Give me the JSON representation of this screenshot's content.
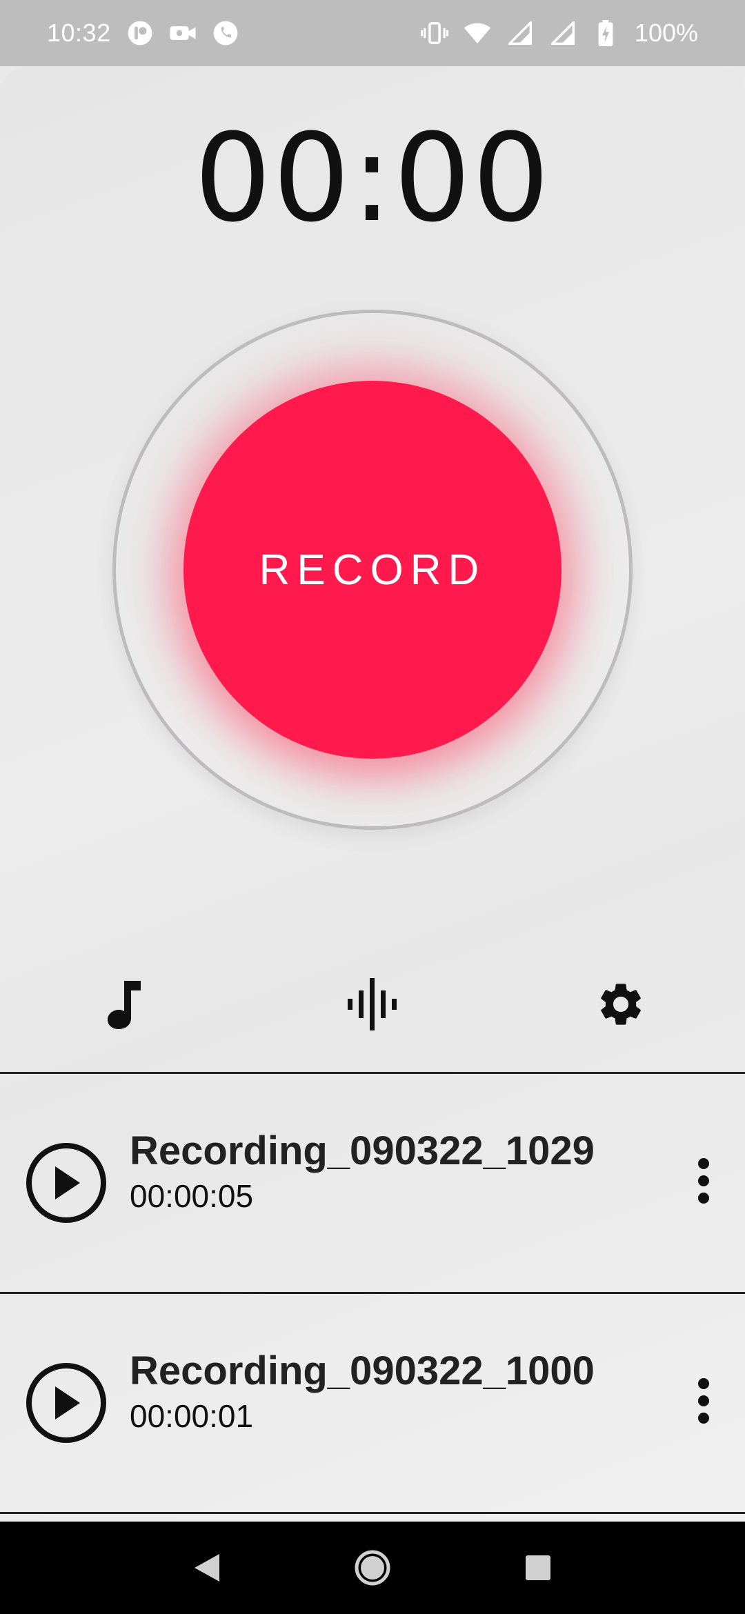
{
  "status_bar": {
    "time": "10:32",
    "battery": "100%",
    "left_icons": [
      "app-notification-icon",
      "video-call-icon",
      "phone-call-icon"
    ],
    "right_icons": [
      "vibrate-icon",
      "wifi-icon",
      "signal-icon",
      "signal-icon",
      "battery-charging-icon"
    ]
  },
  "recorder": {
    "timer": "00:00",
    "record_label": "RECORD",
    "accent_color": "#ff1a4d"
  },
  "toolbar": {
    "icons": [
      "music-note-icon",
      "waveform-icon",
      "settings-gear-icon"
    ]
  },
  "recordings": [
    {
      "title": "Recording_090322_1029",
      "duration": "00:00:05"
    },
    {
      "title": "Recording_090322_1000",
      "duration": "00:00:01"
    }
  ],
  "nav_bar": {
    "icons": [
      "back-icon",
      "home-icon",
      "recents-icon"
    ]
  }
}
